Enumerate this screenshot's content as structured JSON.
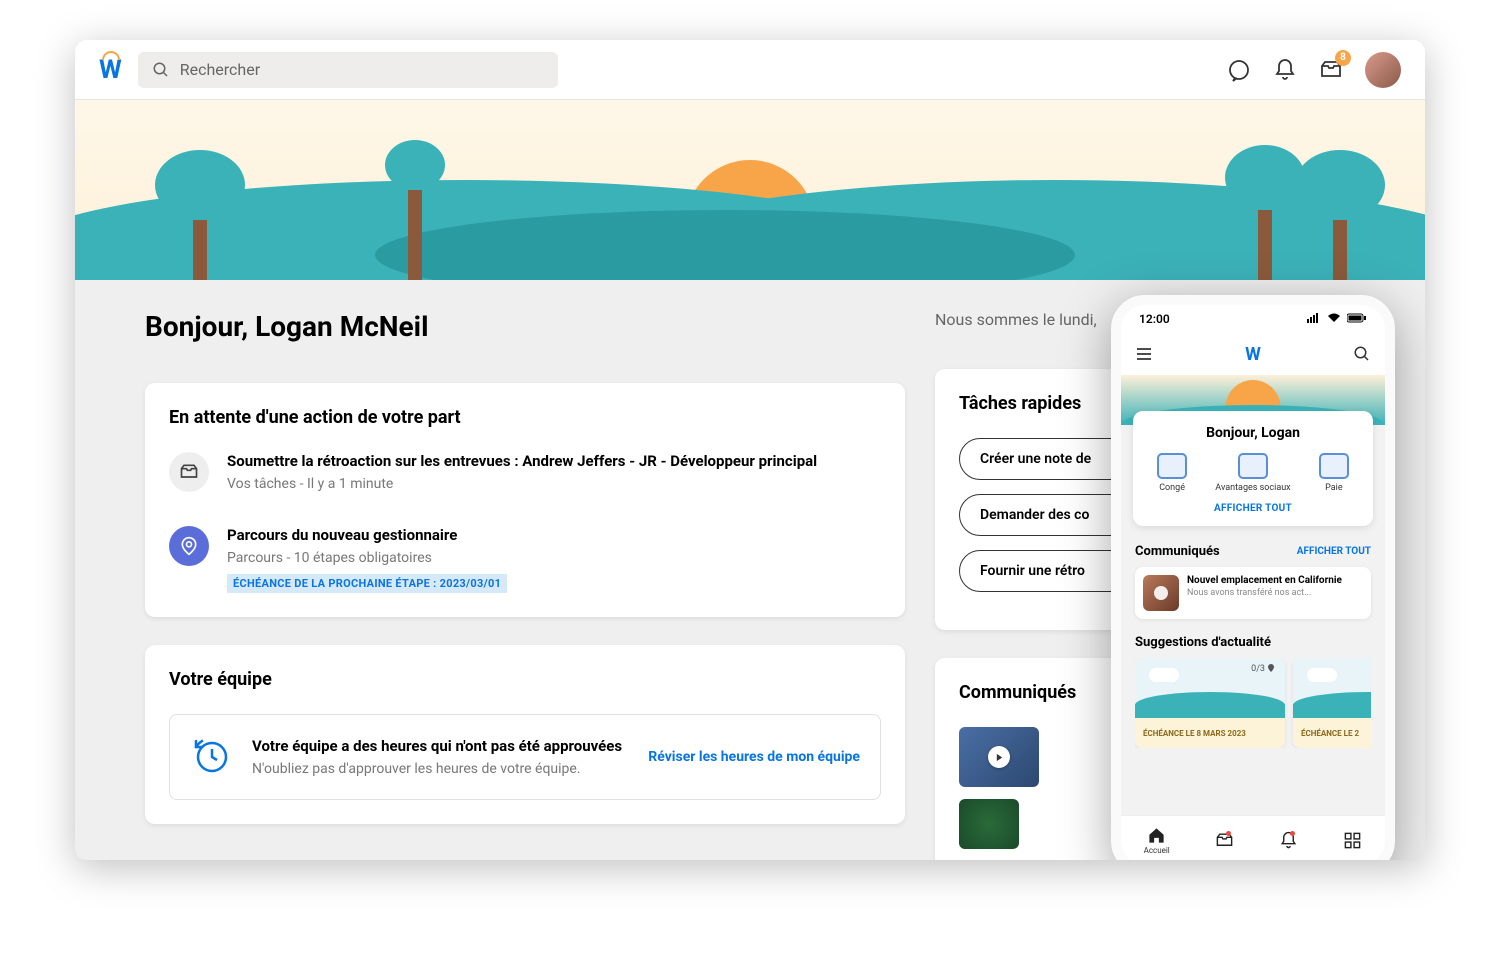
{
  "header": {
    "search_placeholder": "Rechercher",
    "inbox_count": "8"
  },
  "greeting": "Bonjour, Logan McNeil",
  "date_text": "Nous sommes le lundi,",
  "awaiting": {
    "title": "En attente d'une action de votre part",
    "items": [
      {
        "title": "Soumettre la rétroaction sur les entrevues : Andrew Jeffers - JR - Développeur principal",
        "sub": "Vos tâches - Il y a 1 minute"
      },
      {
        "title": "Parcours du nouveau gestionnaire",
        "sub": "Parcours - 10 étapes obligatoires",
        "due": "ÉCHÉANCE DE LA PROCHAINE ÉTAPE : 2023/03/01"
      }
    ]
  },
  "team": {
    "title": "Votre équipe",
    "box_title": "Votre équipe a des heures qui n'ont pas été approuvées",
    "box_sub": "N'oubliez pas d'approuver les heures de votre équipe.",
    "box_link": "Réviser les heures de mon équipe"
  },
  "quick": {
    "title": "Tâches rapides",
    "buttons": [
      "Créer une note de",
      "Demander des co",
      "Fournir une rétro"
    ]
  },
  "communiques": {
    "title": "Communiqués"
  },
  "phone": {
    "time": "12:00",
    "greet": "Bonjour, Logan",
    "icons": [
      "Congé",
      "Avantages sociaux",
      "Paie"
    ],
    "show_all": "AFFICHER TOUT",
    "comm_title": "Communiqués",
    "comm_link": "AFFICHER TOUT",
    "comm_item_title": "Nouvel emplacement en Californie",
    "comm_item_sub": "Nous avons transféré nos act...",
    "sugg_title": "Suggestions d'actualité",
    "sugg_marker": "0/3",
    "sugg_due1": "ÉCHÉANCE LE 8 MARS 2023",
    "sugg_due2": "ÉCHÉANCE LE 2",
    "nav_home": "Accueil"
  }
}
